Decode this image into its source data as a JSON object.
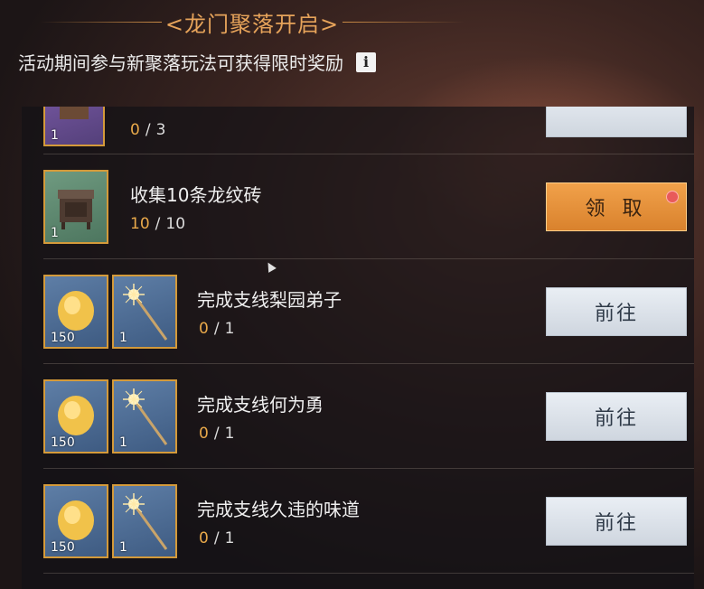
{
  "header": {
    "title": "龙门聚落开启",
    "left_bracket": "<",
    "right_bracket": ">",
    "subtitle": "活动期间参与新聚落玩法可获得限时奖励",
    "info_icon": "i"
  },
  "tasks": [
    {
      "name": "",
      "progress_current": "0",
      "progress_total": "3",
      "rewards": [
        {
          "icon": "purple-item-icon",
          "count": "1"
        }
      ],
      "button": ""
    },
    {
      "name": "收集10条龙纹砖",
      "progress_current": "10",
      "progress_total": "10",
      "rewards": [
        {
          "icon": "chest-icon",
          "count": "1"
        }
      ],
      "button": "领 取",
      "has_notification": true
    },
    {
      "name": "完成支线梨园弟子",
      "progress_current": "0",
      "progress_total": "1",
      "rewards": [
        {
          "icon": "gold-ingot-icon",
          "count": "150"
        },
        {
          "icon": "sparkler-icon",
          "count": "1"
        }
      ],
      "button": "前往"
    },
    {
      "name": "完成支线何为勇",
      "progress_current": "0",
      "progress_total": "1",
      "rewards": [
        {
          "icon": "gold-ingot-icon",
          "count": "150"
        },
        {
          "icon": "sparkler-icon",
          "count": "1"
        }
      ],
      "button": "前往"
    },
    {
      "name": "完成支线久违的味道",
      "progress_current": "0",
      "progress_total": "1",
      "rewards": [
        {
          "icon": "gold-ingot-icon",
          "count": "150"
        },
        {
          "icon": "sparkler-icon",
          "count": "1"
        }
      ],
      "button": "前往"
    }
  ],
  "colors": {
    "accent_gold": "#e6a35a",
    "progress_current": "#e9a94a",
    "claim_button": "#e9963d",
    "go_button": "#dde3ea"
  }
}
